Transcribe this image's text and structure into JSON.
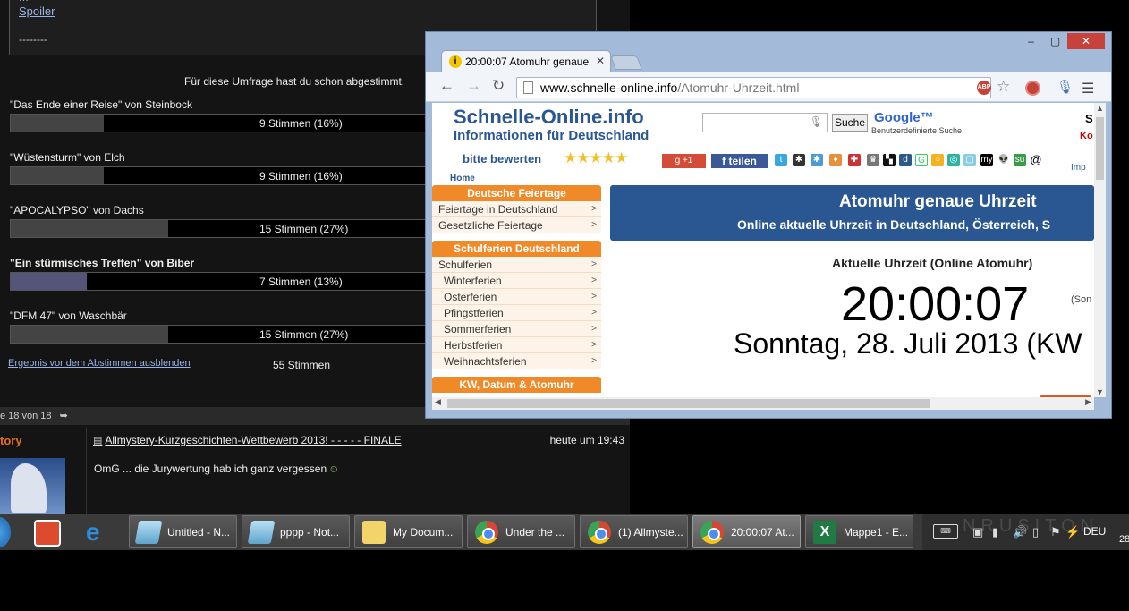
{
  "forum": {
    "spoiler_cut": "...",
    "spoiler_link": "Spoiler",
    "spoiler_dashes": "--------",
    "poll_message": "Für diese Umfrage hast du schon abgestimmt.",
    "poll": [
      {
        "title": "\"Das Ende einer Reise\" von Steinbock",
        "votes": "9 Stimmen (16%)",
        "fraction": 0.16,
        "voted": false
      },
      {
        "title": "\"Wüstensturm\" von Elch",
        "votes": "9 Stimmen (16%)",
        "fraction": 0.16,
        "voted": false
      },
      {
        "title": "\"APOCALYPSO\" von Dachs",
        "votes": "15 Stimmen (27%)",
        "fraction": 0.27,
        "voted": false
      },
      {
        "title": "\"Ein stürmisches Treffen\" von Biber",
        "votes": "7 Stimmen (13%)",
        "fraction": 0.13,
        "voted": true
      },
      {
        "title": "\"DFM 47\" von Waschbär",
        "votes": "15 Stimmen (27%)",
        "fraction": 0.27,
        "voted": false
      }
    ],
    "poll_hide_link": "Ergebnis vor dem Abstimmen ausblenden",
    "poll_total": "55 Stimmen",
    "pager_text": "e 18 von 18",
    "post_author": "tory",
    "post_title": "Allmystery-Kurzgeschichten-Wettbewerb 2013! - - - - - FINALE",
    "post_time": "heute um 19:43",
    "post_body": "OmG ... die Jurywertung hab ich ganz vergessen"
  },
  "browser": {
    "tab_title": "20:00:07 Atomuhr genaue",
    "url_domain": "www.schnelle-online.info",
    "url_path": "/Atomuhr-Uhrzeit.html",
    "abp_label": "ABP",
    "site": {
      "logo_title": "Schnelle-Online.info",
      "logo_subtitle": "Informationen für Deutschland",
      "search_button": "Suche",
      "google_logo": "Google™",
      "google_sub": "Benutzerdefinierte Suche",
      "right_s": "S",
      "right_k": "Ko",
      "rate_label": "bitte bewerten",
      "stars": "★★★★★",
      "gplus": "g +1",
      "fb_share": "f teilen",
      "imp_link": "Imp",
      "home_tab": "Home",
      "sidebar": [
        {
          "heading": "Deutsche Feiertage",
          "items": [
            {
              "label": "Feiertage in Deutschland",
              "sub": false
            },
            {
              "label": "Gesetzliche Feiertage",
              "sub": false
            }
          ]
        },
        {
          "heading": "Schulferien Deutschland",
          "items": [
            {
              "label": "Schulferien",
              "sub": false
            },
            {
              "label": "Winterferien",
              "sub": true
            },
            {
              "label": "Osterferien",
              "sub": true
            },
            {
              "label": "Pfingstferien",
              "sub": true
            },
            {
              "label": "Sommerferien",
              "sub": true
            },
            {
              "label": "Herbstferien",
              "sub": true
            },
            {
              "label": "Weihnachtsferien",
              "sub": true
            }
          ]
        },
        {
          "heading": "KW, Datum & Atomuhr",
          "items": []
        }
      ],
      "banner_title": "Atomuhr genaue Uhrzeit",
      "banner_subtitle": "Online aktuelle Uhrzeit in Deutschland, Österreich, S",
      "clock_caption": "Aktuelle Uhrzeit (Online Atomuhr)",
      "clock_time": "20:00:07",
      "clock_side": "(Son",
      "clock_date": "Sonntag, 28. Juli 2013 (KW"
    }
  },
  "taskbar": {
    "items": [
      {
        "label": "Untitled - N...",
        "icon": "notepad-icon",
        "active": false
      },
      {
        "label": "pppp - Not...",
        "icon": "notepad-icon",
        "active": false
      },
      {
        "label": "My Docum...",
        "icon": "folder-icon",
        "active": false
      },
      {
        "label": "Under the ...",
        "icon": "chrome-icon",
        "active": false
      },
      {
        "label": "(1) Allmyste...",
        "icon": "chrome-icon",
        "active": false
      },
      {
        "label": "20:00:07 At...",
        "icon": "chrome-icon",
        "active": true
      },
      {
        "label": "Mappe1 - E...",
        "icon": "excel-icon",
        "active": false
      }
    ],
    "tray_lang": "DEU",
    "tray_clock": "28",
    "watermark": "NRUSITON"
  },
  "colors": {
    "accent_orange": "#f08a28",
    "site_blue": "#2a5791",
    "close_red": "#c7423a"
  }
}
